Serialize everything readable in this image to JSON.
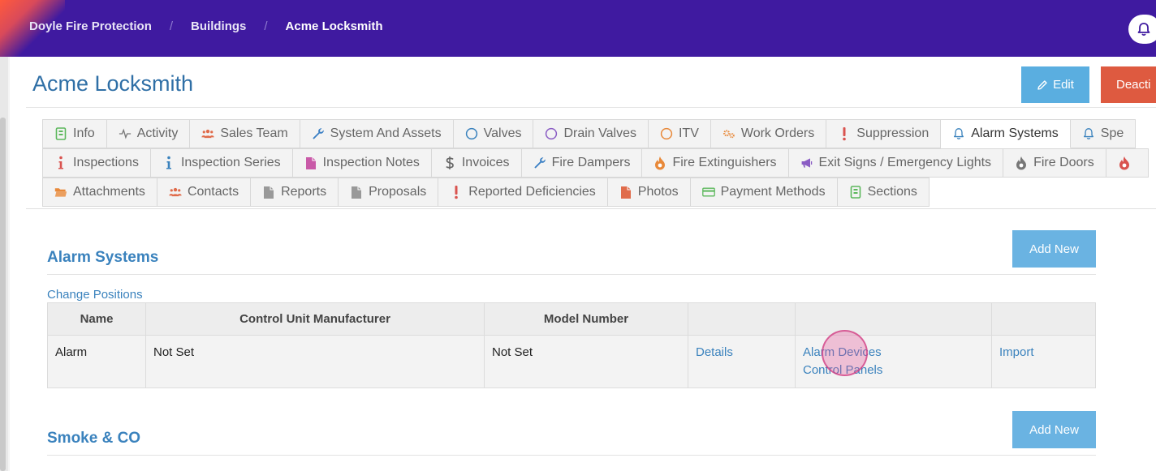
{
  "breadcrumb": {
    "items": [
      "Doyle Fire Protection",
      "Buildings",
      "Acme Locksmith"
    ]
  },
  "page": {
    "title": "Acme Locksmith"
  },
  "header_actions": {
    "edit_label": "Edit",
    "deactivate_label": "Deacti"
  },
  "tabs": {
    "row1": [
      {
        "label": "Info",
        "icon": "info-card-icon",
        "color": "#5cb85c"
      },
      {
        "label": "Activity",
        "icon": "pulse-icon",
        "color": "#777777"
      },
      {
        "label": "Sales Team",
        "icon": "users-icon",
        "color": "#e06b4a"
      },
      {
        "label": "System And Assets",
        "icon": "wrench-icon",
        "color": "#3a7fc4"
      },
      {
        "label": "Valves",
        "icon": "circle-icon",
        "color": "#3a82bd"
      },
      {
        "label": "Drain Valves",
        "icon": "circle-icon",
        "color": "#8a5cc4"
      },
      {
        "label": "ITV",
        "icon": "circle-icon",
        "color": "#e8893a"
      },
      {
        "label": "Work Orders",
        "icon": "gears-icon",
        "color": "#e8893a"
      },
      {
        "label": "Suppression",
        "icon": "exclamation-icon",
        "color": "#d9534f"
      },
      {
        "label": "Alarm Systems",
        "icon": "bell-icon",
        "color": "#3a82bd",
        "active": true
      },
      {
        "label": "Spe",
        "icon": "bell-icon",
        "color": "#3a82bd"
      }
    ],
    "row2": [
      {
        "label": "Inspections",
        "icon": "info-icon",
        "color": "#d9534f"
      },
      {
        "label": "Inspection Series",
        "icon": "info-icon",
        "color": "#3a82bd"
      },
      {
        "label": "Inspection Notes",
        "icon": "file-icon",
        "color": "#c95aa8"
      },
      {
        "label": "Invoices",
        "icon": "dollar-icon",
        "color": "#666666"
      },
      {
        "label": "Fire Dampers",
        "icon": "wrench-icon",
        "color": "#3a7fc4"
      },
      {
        "label": "Fire Extinguishers",
        "icon": "flame-icon",
        "color": "#e8893a"
      },
      {
        "label": "Exit Signs / Emergency Lights",
        "icon": "megaphone-icon",
        "color": "#8a5cc4"
      },
      {
        "label": "Fire Doors",
        "icon": "flame-icon",
        "color": "#777777"
      },
      {
        "label": "",
        "icon": "flame-icon",
        "color": "#d9534f"
      }
    ],
    "row3": [
      {
        "label": "Attachments",
        "icon": "folder-icon",
        "color": "#e8893a"
      },
      {
        "label": "Contacts",
        "icon": "users-icon",
        "color": "#e06b4a"
      },
      {
        "label": "Reports",
        "icon": "file-icon",
        "color": "#999999"
      },
      {
        "label": "Proposals",
        "icon": "file-icon",
        "color": "#999999"
      },
      {
        "label": "Reported Deficiencies",
        "icon": "exclamation-icon",
        "color": "#d9534f"
      },
      {
        "label": "Photos",
        "icon": "file-icon",
        "color": "#e06b4a"
      },
      {
        "label": "Payment Methods",
        "icon": "card-icon",
        "color": "#5cb85c"
      },
      {
        "label": "Sections",
        "icon": "info-card-icon",
        "color": "#5cb85c"
      }
    ]
  },
  "alarm_section": {
    "title": "Alarm Systems",
    "add_label": "Add New",
    "change_positions_label": "Change Positions",
    "columns": [
      "Name",
      "Control Unit Manufacturer",
      "Model Number",
      "",
      "",
      ""
    ],
    "rows": [
      {
        "name": "Alarm",
        "manufacturer": "Not Set",
        "model": "Not Set",
        "details_link": "Details",
        "devices_link": "Alarm Devices",
        "panels_link": "Control Panels",
        "import_link": "Import"
      }
    ]
  },
  "smoke_section": {
    "title": "Smoke & CO",
    "add_label": "Add New"
  },
  "colors": {
    "topbar": "#3f1aa0",
    "accent": "#3a82bd",
    "edit": "#5aaee0",
    "deactivate": "#de5a40"
  }
}
